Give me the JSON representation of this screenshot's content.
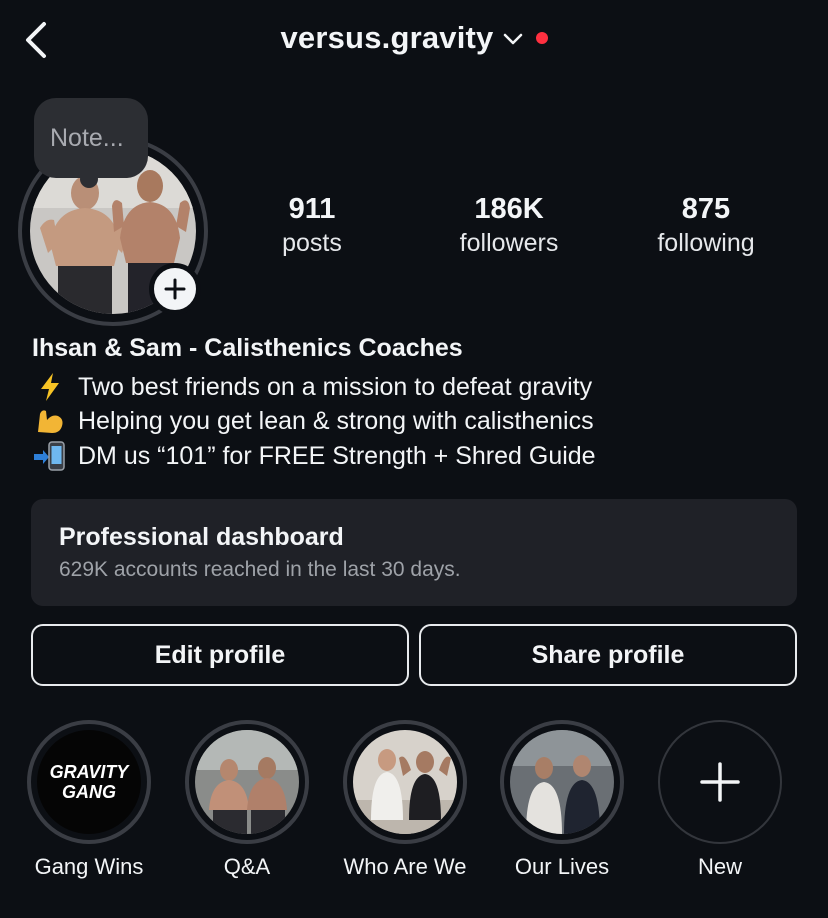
{
  "header": {
    "username": "versus.gravity",
    "icons": [
      "chevron-left-icon",
      "chevron-down-icon",
      "notification-dot"
    ],
    "dot_color": "#ff3040"
  },
  "note": {
    "placeholder": "Note..."
  },
  "stats": [
    {
      "value": "911",
      "label": "posts"
    },
    {
      "value": "186K",
      "label": "followers"
    },
    {
      "value": "875",
      "label": "following"
    }
  ],
  "bio": {
    "name": "Ihsan & Sam - Calisthenics Coaches",
    "lines": [
      {
        "icon": "lightning-icon",
        "text": "Two best friends on a mission to defeat gravity"
      },
      {
        "icon": "flexed-bicep-icon",
        "text": "Helping you get lean & strong with calisthenics"
      },
      {
        "icon": "phone-arrow-icon",
        "text": "DM us “101” for FREE Strength + Shred Guide"
      }
    ]
  },
  "dashboard": {
    "title": "Professional dashboard",
    "subtitle": "629K accounts reached in the last 30 days."
  },
  "buttons": {
    "edit": "Edit profile",
    "share": "Share profile"
  },
  "highlights": [
    {
      "label": "Gang Wins",
      "logo_line1": "GRAVITY",
      "logo_line2": "GANG"
    },
    {
      "label": "Q&A"
    },
    {
      "label": "Who Are We"
    },
    {
      "label": "Our Lives"
    },
    {
      "label": "New"
    }
  ]
}
